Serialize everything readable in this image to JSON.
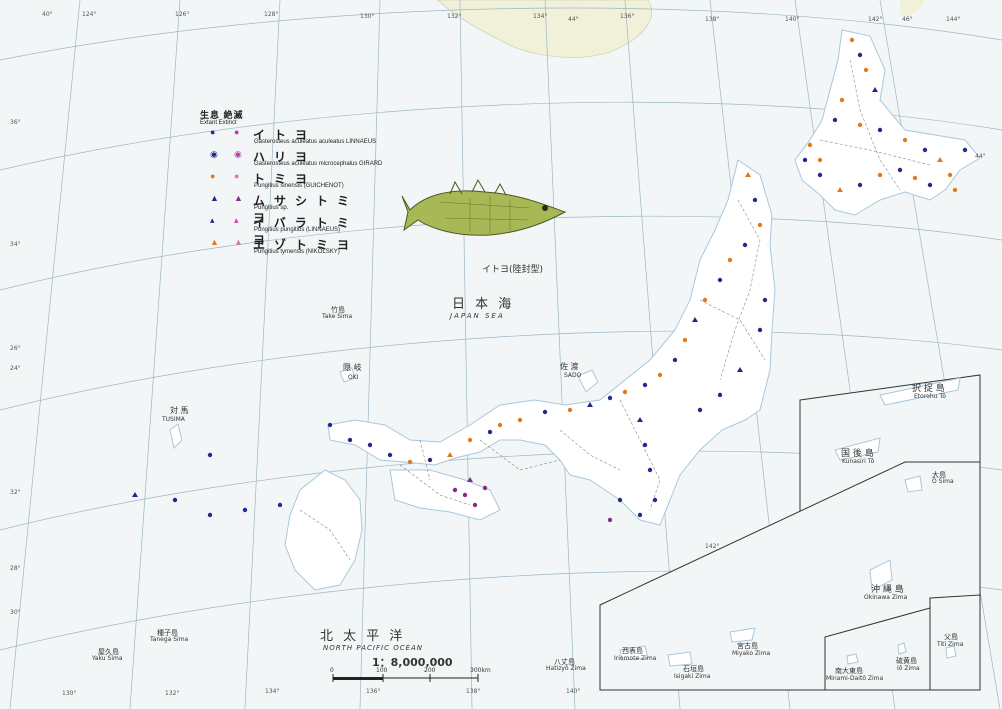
{
  "legend": {
    "status_jp": "生息  絶滅",
    "status_en": "Extant  Extinct",
    "species": [
      {
        "jp": "イトヨ",
        "latin": "Gasterosteus aculeatus aculeatus LINNAEUS",
        "shape": "circle",
        "color": "#1f2a8a",
        "extinct_color": "#b43fb0"
      },
      {
        "jp": "ハリヨ",
        "latin": "Gasterosteus aculeatus microcephalus GIRARD",
        "shape": "ring",
        "color": "#1f2a8a",
        "extinct_color": "#b43fb0"
      },
      {
        "jp": "トミヨ",
        "latin": "Pungitius sinensis (GUICHENOT)",
        "shape": "circle",
        "color": "#e07a1f",
        "extinct_color": "#e07aa0"
      },
      {
        "jp": "ムサシトミヨ",
        "latin": "Pungitius sp.",
        "shape": "triangle",
        "color": "#1f2a8a",
        "extinct_color": "#8a2a8a"
      },
      {
        "jp": "イバラトミヨ",
        "latin": "Pungitius pungitius (LINNAEUS)",
        "shape": "triangle-small",
        "color": "#1f2a8a",
        "extinct_color": "#d23fa0"
      },
      {
        "jp": "エゾトミヨ",
        "latin": "Pungitius tymensis (NIKOLSKY)",
        "shape": "triangle",
        "color": "#e07a1f",
        "extinct_color": "#d27ab0"
      }
    ]
  },
  "fish_caption": "イトヨ(陸封型)",
  "seas": {
    "japan_sea_jp": "日 本 海",
    "japan_sea_en": "JAPAN SEA",
    "pacific_jp": "北 太 平 洋",
    "pacific_en": "NORTH PACIFIC OCEAN"
  },
  "places": [
    {
      "jp": "竹島",
      "en": "Take Sima"
    },
    {
      "jp": "隠 岐",
      "en": "OKI"
    },
    {
      "jp": "佐 渡",
      "en": "SADO"
    },
    {
      "jp": "対 馬",
      "en": "TUSIMA"
    },
    {
      "jp": "種子島",
      "en": "Tanega Sima"
    },
    {
      "jp": "屋久島",
      "en": "Yaku Sima"
    },
    {
      "jp": "八丈島",
      "en": "Hatizyô Zima"
    }
  ],
  "insets": [
    {
      "jp": "択 捉 島",
      "en": "Etorohu Tô"
    },
    {
      "jp": "国 後 島",
      "en": "Kunasiri Tô"
    },
    {
      "jp": "大島",
      "en": "Ô Sima"
    },
    {
      "jp": "沖 縄 島",
      "en": "Okinawa Zima"
    },
    {
      "jp": "宮古島",
      "en": "Miyako Zima"
    },
    {
      "jp": "西表島",
      "en": "Iriomote Zima"
    },
    {
      "jp": "石垣島",
      "en": "Isigaki Zima"
    },
    {
      "jp": "南大東島",
      "en": "Minami-Daitô Zima"
    },
    {
      "jp": "硫黄島",
      "en": "Iô Zima"
    },
    {
      "jp": "父島",
      "en": "Titi Zima"
    }
  ],
  "scale": {
    "ratio": "1：8,000,000",
    "ticks": [
      "0",
      "100",
      "200",
      "300km"
    ]
  },
  "graticule": {
    "top": [
      "124°",
      "126°",
      "128°",
      "130°",
      "132°",
      "134°",
      "136°",
      "138°",
      "140°",
      "142°",
      "144°"
    ],
    "top_lat": [
      "40°",
      "44°",
      "46°",
      "44°"
    ],
    "left": [
      "36°",
      "34°",
      "26°",
      "24°",
      "32°",
      "30°",
      "28°"
    ],
    "bottom": [
      "130°",
      "132°",
      "134°",
      "136°",
      "138°",
      "140°",
      "142°"
    ]
  },
  "colors": {
    "sea": "#f2f6f7",
    "land": "#ffffff",
    "grid": "#9db7c5",
    "coast": "#a8c8dc",
    "border": "#888888",
    "china": "#f1f0d9"
  }
}
